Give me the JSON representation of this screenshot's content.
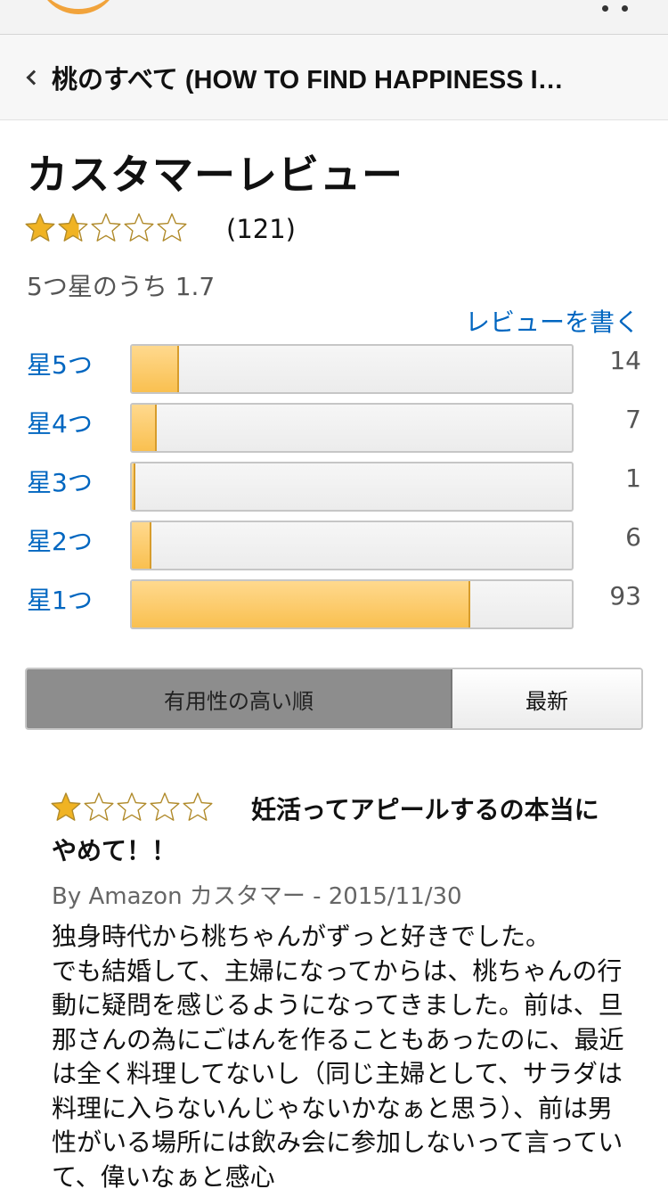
{
  "header": {
    "breadcrumb_title": "桃のすべて (HOW TO FIND HAPPINESS I…"
  },
  "reviews_section": {
    "title": "カスタマーレビュー",
    "overall_rating": 1.7,
    "review_count": "(121)",
    "average_text": "5つ星のうち 1.7",
    "write_review_link": "レビューを書く",
    "histogram": [
      {
        "label": "星5つ",
        "count": "14",
        "fraction": 0.107
      },
      {
        "label": "星4つ",
        "count": "7",
        "fraction": 0.056
      },
      {
        "label": "星3つ",
        "count": "1",
        "fraction": 0.008
      },
      {
        "label": "星2つ",
        "count": "6",
        "fraction": 0.045
      },
      {
        "label": "星1つ",
        "count": "93",
        "fraction": 0.77
      }
    ],
    "sort": {
      "helpful_label": "有用性の高い順",
      "newest_label": "最新",
      "selected": "helpful"
    }
  },
  "review": {
    "rating": 1,
    "title": "妊活ってアピールするの本当にやめて！！",
    "byline": "By Amazon カスタマー - 2015/11/30",
    "body": "独身時代から桃ちゃんがずっと好きでした。\nでも結婚して、主婦になってからは、桃ちゃんの行動に疑問を感じるようになってきました。前は、旦那さんの為にごはんを作ることもあったのに、最近は全く料理してないし（同じ主婦として、サラダは料理に入らないんじゃないかなぁと思う）、前は男性がいる場所には飲み会に参加しないって言っていて、偉いなぁと感心"
  },
  "colors": {
    "star_gold": "#f0b323",
    "link_blue": "#0066c0",
    "bar_fill": "#f9c050",
    "logo_orange": "#f1a33b"
  },
  "icons": {
    "back": "chevron-left-icon",
    "menu": "more-dots-icon",
    "logo": "amazon-smile-logo"
  }
}
